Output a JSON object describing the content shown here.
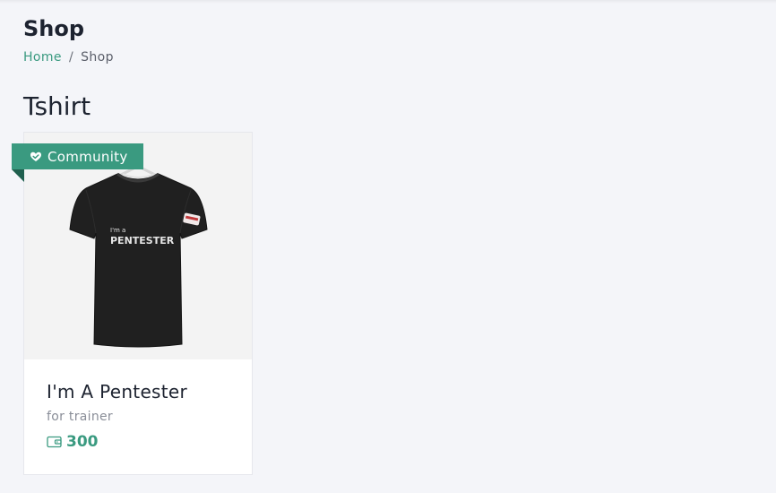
{
  "header": {
    "title": "Shop",
    "breadcrumb": {
      "home": "Home",
      "separator": "/",
      "current": "Shop"
    }
  },
  "category": {
    "title": "Tshirt"
  },
  "products": [
    {
      "badge": "Community",
      "shirt_text_small": "I'm a",
      "shirt_text_big": "PENTESTER",
      "name": "I'm A Pentester",
      "subtitle": "for trainer",
      "price": "300"
    }
  ],
  "colors": {
    "accent": "#3a9a80",
    "ribbon_fold": "#1f5f4e",
    "background": "#f4f5f9",
    "text_dark": "#1d2330"
  },
  "icons": {
    "badge": "heart-hand-icon",
    "price": "wallet-icon"
  }
}
